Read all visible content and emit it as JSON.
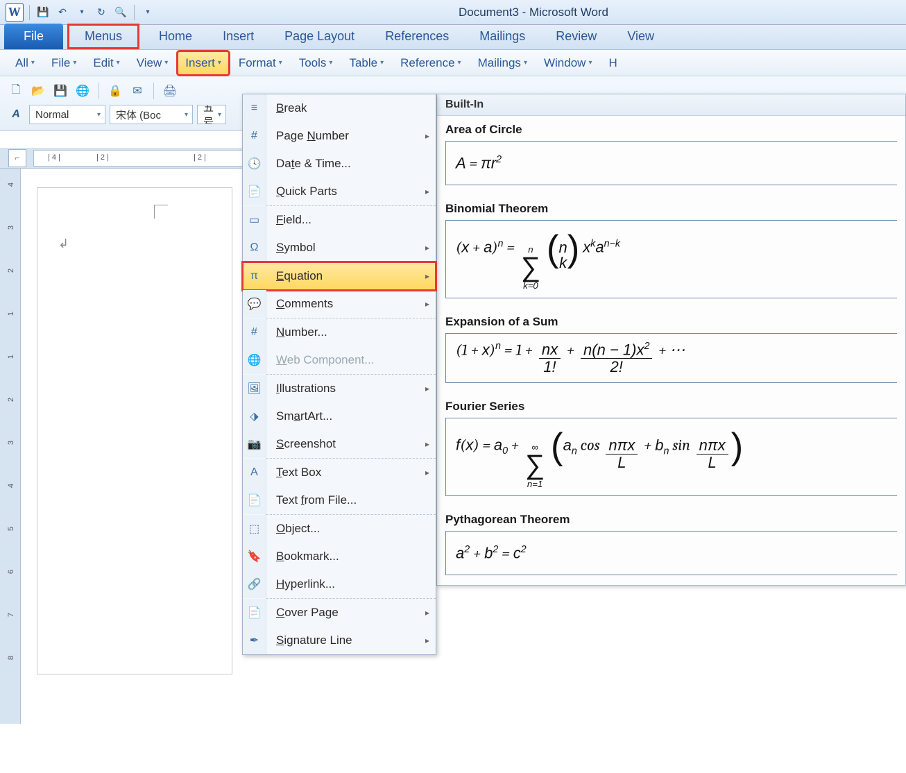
{
  "titlebar": {
    "title": "Document3  -  Microsoft Word"
  },
  "ribbon_tabs": {
    "file": "File",
    "menus": "Menus",
    "home": "Home",
    "insert": "Insert",
    "page_layout": "Page Layout",
    "references": "References",
    "mailings": "Mailings",
    "review": "Review",
    "view": "View"
  },
  "menubar": {
    "all": "All",
    "file": "File",
    "edit": "Edit",
    "view": "View",
    "insert": "Insert",
    "format": "Format",
    "tools": "Tools",
    "table": "Table",
    "reference": "Reference",
    "mailings": "Mailings",
    "window": "Window",
    "help_initial": "H"
  },
  "toolbar": {
    "style": "Normal",
    "font": "宋体 (Boc",
    "size": "五号"
  },
  "ruler": {
    "marks": [
      "| 4 |",
      "| 2 |",
      "| 2 |"
    ]
  },
  "vruler": {
    "marks": [
      "4",
      "3",
      "2",
      "1",
      "1",
      "2",
      "3",
      "4",
      "5",
      "6",
      "7",
      "8"
    ]
  },
  "insert_menu": {
    "break": "Break",
    "page_number": "Page Number",
    "date_time": "Date & Time...",
    "quick_parts": "Quick Parts",
    "field": "Field...",
    "symbol": "Symbol",
    "equation": "Equation",
    "comments": "Comments",
    "number": "Number...",
    "web_component": "Web Component...",
    "illustrations": "Illustrations",
    "smartart": "SmartArt...",
    "screenshot": "Screenshot",
    "text_box": "Text Box",
    "text_from_file": "Text from File...",
    "object": "Object...",
    "bookmark": "Bookmark...",
    "hyperlink": "Hyperlink...",
    "cover_page": "Cover Page",
    "signature_line": "Signature Line"
  },
  "gallery": {
    "header": "Built-In",
    "items": [
      {
        "title": "Area of Circle",
        "eq_html": "<i>A</i> = <i>πr</i><sup>2</sup>"
      },
      {
        "title": "Binomial Theorem",
        "eq_html": "(<i>x</i> + <i>a</i>)<sup><i>n</i></sup> = <span class='sigma-block'><span class='top'>n</span><span class='sig'>∑</span><span class='bot'>k=0</span></span> <span class='paren-l'>(</span><span class='binom'><span><i>n</i></span><span><i>k</i></span></span><span class='paren-r'>)</span> <i>x</i><sup><i>k</i></sup><i>a</i><sup><i>n−k</i></sup>"
      },
      {
        "title": "Expansion of a Sum",
        "eq_html": "(1 + <i>x</i>)<sup><i>n</i></sup> = 1 + <span class='frac'><span class='num'><i>nx</i></span><span class='den'>1!</span></span> + <span class='frac'><span class='num'><i>n</i>(<i>n</i> − 1)<i>x</i><sup>2</sup></span><span class='den'>2!</span></span> + ⋯"
      },
      {
        "title": "Fourier Series",
        "eq_html": "<i>f</i>(<i>x</i>) = <i>a</i><sub>0</sub> + <span class='sigma-block'><span class='top'>∞</span><span class='sig'>∑</span><span class='bot'>n=1</span></span> <span class='paren-l'>(</span><i>a<sub>n</sub></i> cos <span class='frac'><span class='num'><i>nπx</i></span><span class='den'><i>L</i></span></span> + <i>b<sub>n</sub></i> sin <span class='frac'><span class='num'><i>nπx</i></span><span class='den'><i>L</i></span></span><span class='paren-r'>)</span>"
      },
      {
        "title": "Pythagorean Theorem",
        "eq_html": "<i>a</i><sup>2</sup> + <i>b</i><sup>2</sup> = <i>c</i><sup>2</sup>"
      }
    ]
  }
}
